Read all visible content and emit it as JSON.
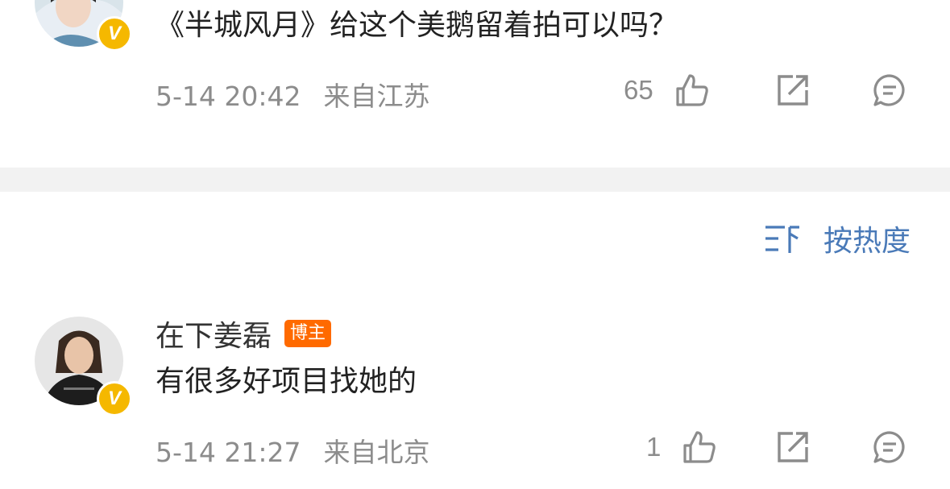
{
  "comment1": {
    "text": "《半城风月》给这个美鹅留着拍可以吗？",
    "time": "5-14 20:42",
    "location": "来自江苏",
    "like_count": "65",
    "verified_badge": "V"
  },
  "sort": {
    "icon": "sort-icon",
    "label": "按热度"
  },
  "comment2": {
    "username": "在下姜磊",
    "tag": "博主",
    "text": "有很多好项目找她的",
    "time": "5-14 21:27",
    "location": "来自北京",
    "like_count": "1",
    "verified_badge": "V"
  },
  "icons": [
    "thumbs-up-icon",
    "repost-icon",
    "comment-icon"
  ],
  "colors": {
    "link_blue": "#4a7ab8",
    "tag_orange": "#ff6a00",
    "badge_yellow": "#f5b800",
    "meta_gray": "#8c8c8c"
  }
}
